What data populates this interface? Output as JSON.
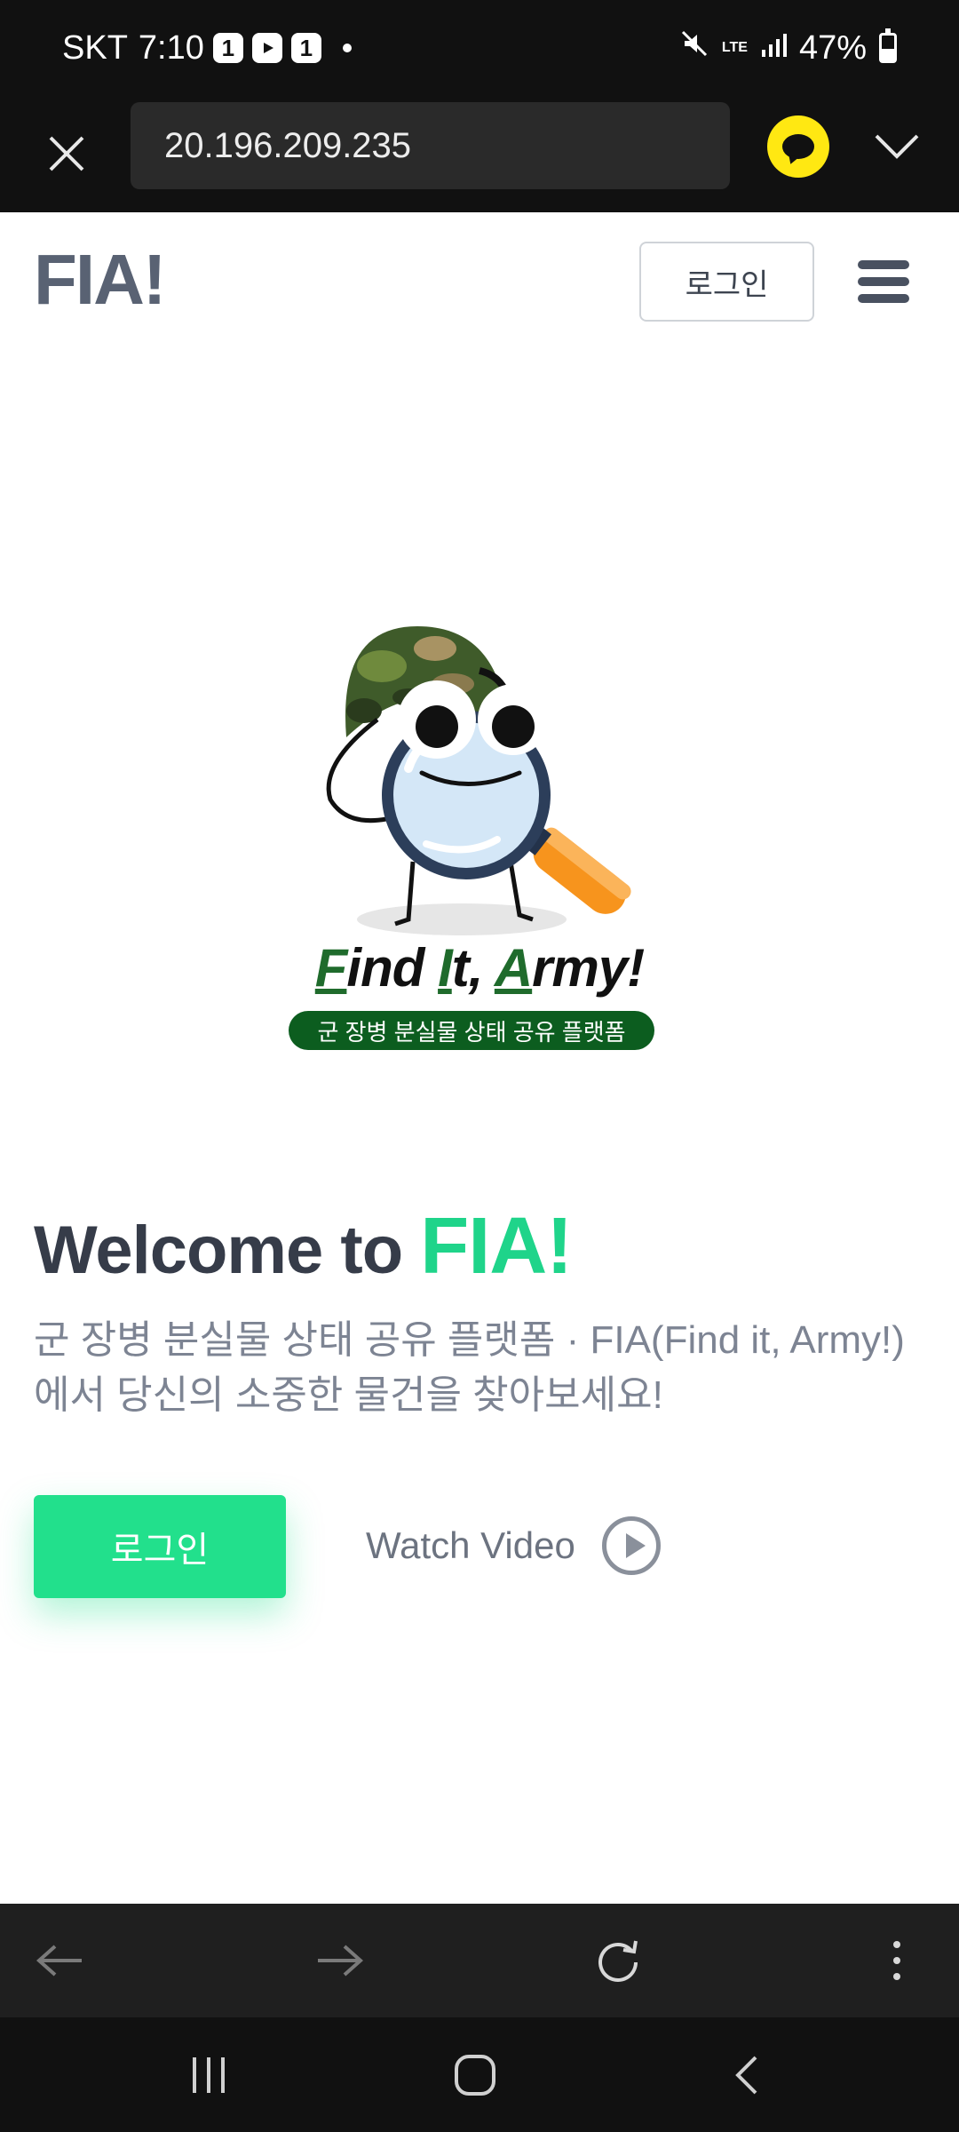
{
  "status_bar": {
    "carrier": "SKT",
    "time": "7:10",
    "notifications": [
      {
        "name": "one-icon",
        "label": "1"
      },
      {
        "name": "youtube-icon",
        "label": ""
      },
      {
        "name": "one-icon",
        "label": "1"
      }
    ],
    "network": "LTE",
    "battery_percent": "47%",
    "battery_level": 0.47
  },
  "browser": {
    "url": "20.196.209.235",
    "close_icon": "close-icon",
    "talk_icon": "kakaotalk-icon",
    "expand_icon": "chevron-down-icon"
  },
  "header": {
    "brand": "FIA!",
    "login_label": "로그인",
    "menu_icon": "hamburger-menu-icon"
  },
  "hero": {
    "logo_title_parts": [
      "F",
      "ind ",
      "I",
      "t, ",
      "A",
      "rmy!"
    ],
    "logo_tagline": "군 장병 분실물 상태 공유 플랫폼"
  },
  "welcome": {
    "prefix": "Welcome to ",
    "accent": "FIA!",
    "subtitle": "군 장병 분실물 상태 공유 플랫폼 · FIA(Find it, Army!)에서 당신의 소중한 물건을 찾아보세요!"
  },
  "cta": {
    "login_label": "로그인",
    "watch_label": "Watch Video"
  },
  "colors": {
    "accent": "#22e08c",
    "brand_gray": "#596273",
    "logo_green": "#0c5d1f"
  }
}
